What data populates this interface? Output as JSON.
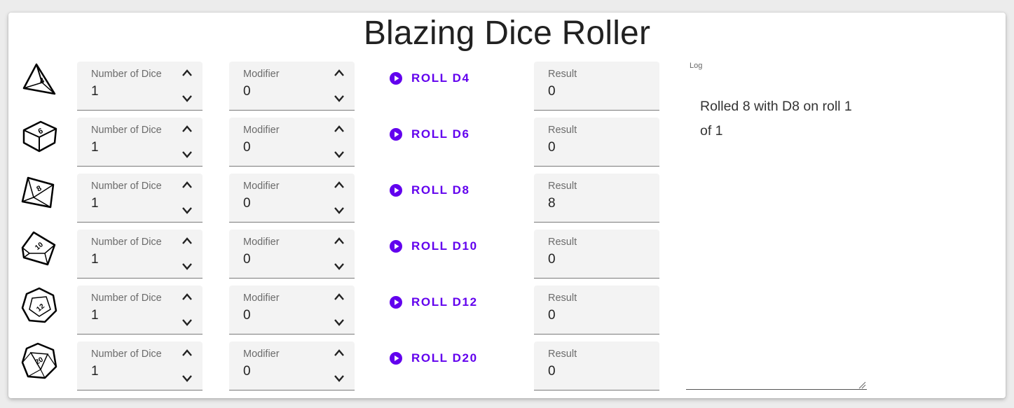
{
  "app": {
    "title": "Blazing Dice Roller"
  },
  "labels": {
    "number_of_dice": "Number of Dice",
    "modifier": "Modifier",
    "result": "Result"
  },
  "dice": [
    {
      "face": "4",
      "number": "1",
      "modifier": "0",
      "roll_label": "ROLL D4",
      "result": "0"
    },
    {
      "face": "6",
      "number": "1",
      "modifier": "0",
      "roll_label": "ROLL D6",
      "result": "0"
    },
    {
      "face": "8",
      "number": "1",
      "modifier": "0",
      "roll_label": "ROLL D8",
      "result": "8"
    },
    {
      "face": "10",
      "number": "1",
      "modifier": "0",
      "roll_label": "ROLL D10",
      "result": "0"
    },
    {
      "face": "12",
      "number": "1",
      "modifier": "0",
      "roll_label": "ROLL D12",
      "result": "0"
    },
    {
      "face": "20",
      "number": "1",
      "modifier": "0",
      "roll_label": "ROLL D20",
      "result": "0"
    }
  ],
  "log": {
    "label": "Log",
    "text": "Rolled 8 with D8 on roll 1 of 1"
  },
  "colors": {
    "accent": "#6200ee",
    "field_bg": "#f3f3f3",
    "page_bg": "#ececec"
  },
  "icons": [
    "d4-icon",
    "d6-icon",
    "d8-icon",
    "d10-icon",
    "d12-icon",
    "d20-icon",
    "play-circle-icon",
    "chevron-up-icon",
    "chevron-down-icon",
    "resize-handle-icon"
  ]
}
